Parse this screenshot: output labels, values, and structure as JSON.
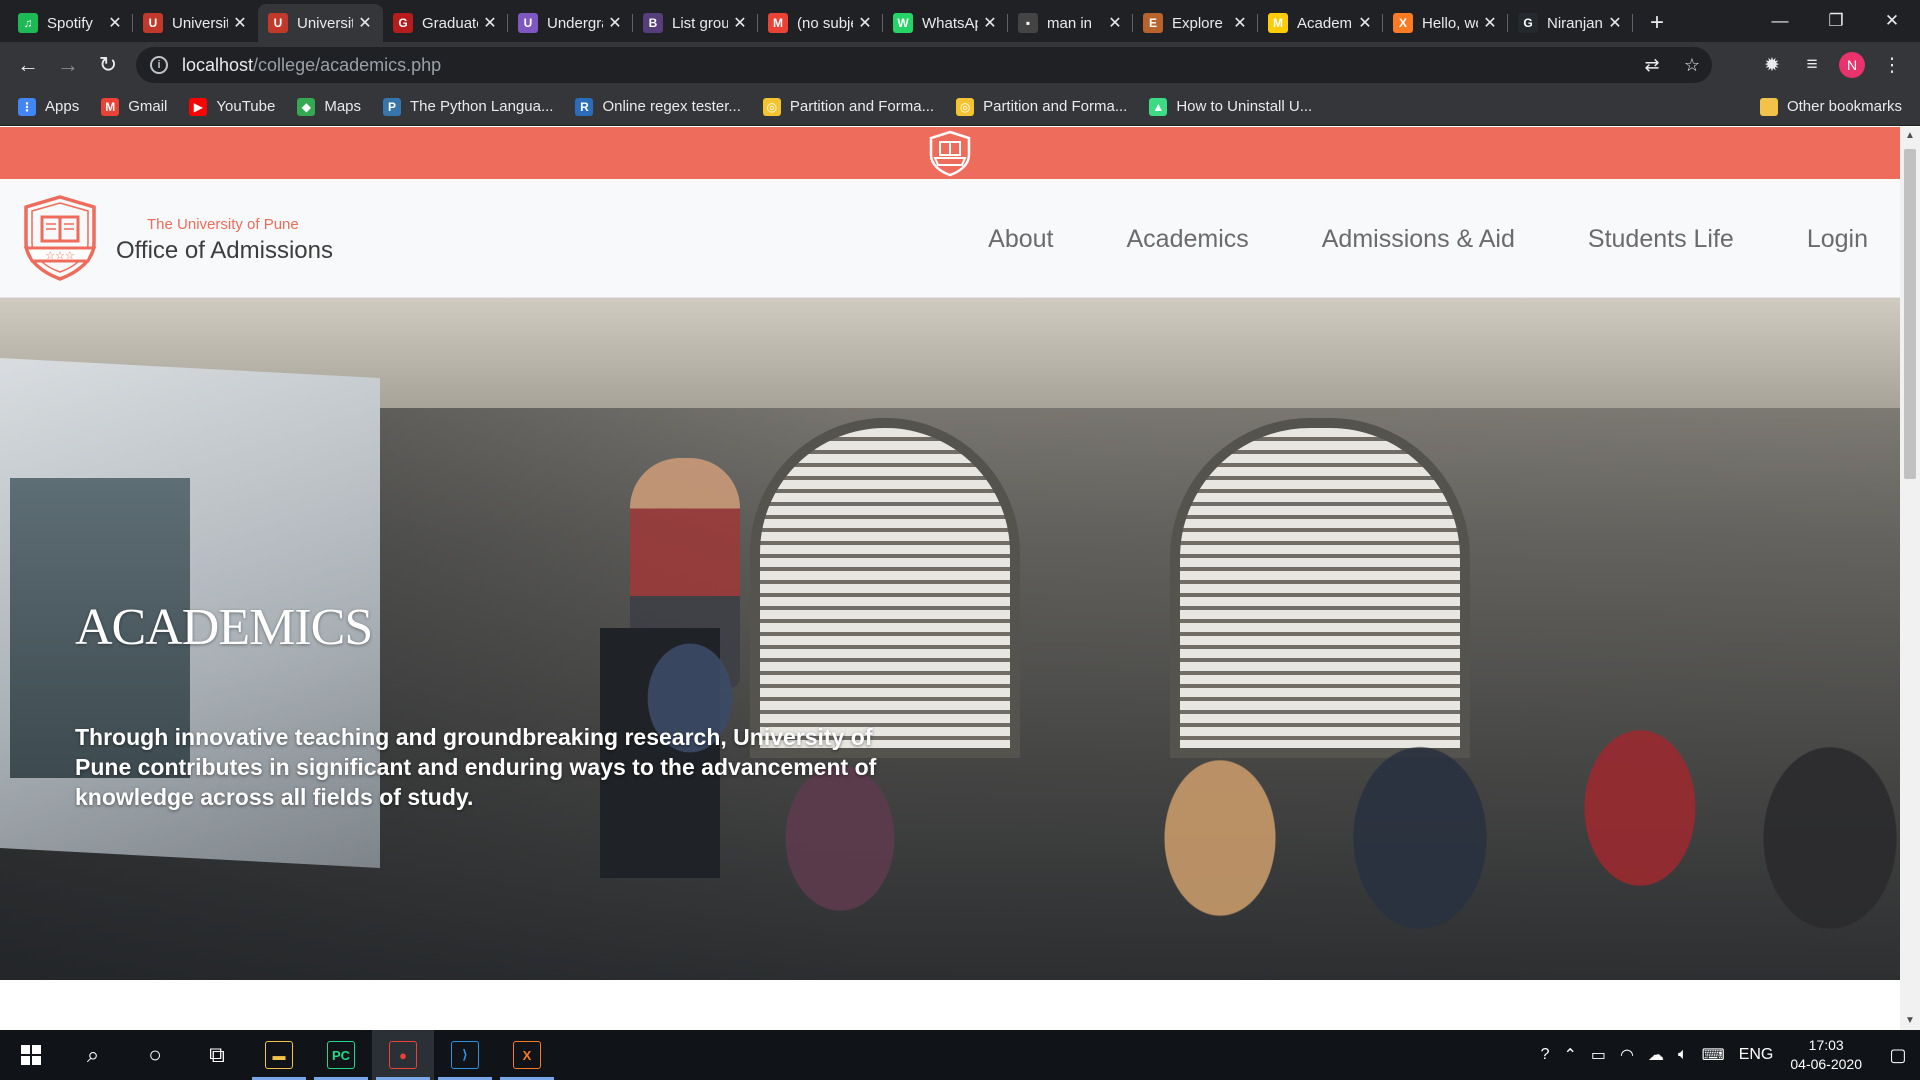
{
  "browser": {
    "tabs": [
      {
        "label": "Spotify",
        "color": "#1db954",
        "glyph": "♫"
      },
      {
        "label": "University",
        "color": "#c0392b",
        "glyph": "U"
      },
      {
        "label": "University",
        "color": "#c0392b",
        "glyph": "U"
      },
      {
        "label": "Graduate",
        "color": "#b71c1c",
        "glyph": "G"
      },
      {
        "label": "Undergraduate",
        "color": "#7e57c2",
        "glyph": "U"
      },
      {
        "label": "List group",
        "color": "#563d7c",
        "glyph": "B"
      },
      {
        "label": "(no subject)",
        "color": "#ea4335",
        "glyph": "M"
      },
      {
        "label": "WhatsApp",
        "color": "#25d366",
        "glyph": "W"
      },
      {
        "label": "man in",
        "color": "#444444",
        "glyph": "▪"
      },
      {
        "label": "Explore",
        "color": "#b8632b",
        "glyph": "E"
      },
      {
        "label": "Academics",
        "color": "#ffcb05",
        "glyph": "M"
      },
      {
        "label": "Hello, world",
        "color": "#fb7a24",
        "glyph": "X"
      },
      {
        "label": "Niranjan",
        "color": "#24292e",
        "glyph": "G"
      }
    ],
    "active_tab_index": 2,
    "new_tab_label": "+",
    "window_controls": {
      "minimize": "—",
      "restore": "❐",
      "close": "✕"
    },
    "url_host": "localhost",
    "url_path": "/college/academics.php",
    "bookmarks": [
      {
        "label": "Apps",
        "color": "#4285f4",
        "glyph": "⋮"
      },
      {
        "label": "Gmail",
        "color": "#ea4335",
        "glyph": "M"
      },
      {
        "label": "YouTube",
        "color": "#ff0000",
        "glyph": "▶"
      },
      {
        "label": "Maps",
        "color": "#34a853",
        "glyph": "◆"
      },
      {
        "label": "The Python Langua...",
        "color": "#3776ab",
        "glyph": "P"
      },
      {
        "label": "Online regex tester...",
        "color": "#2a6ebb",
        "glyph": "R"
      },
      {
        "label": "Partition and Forma...",
        "color": "#f4c430",
        "glyph": "◎"
      },
      {
        "label": "Partition and Forma...",
        "color": "#f4c430",
        "glyph": "◎"
      },
      {
        "label": "How to Uninstall U...",
        "color": "#3ddc84",
        "glyph": "▲"
      }
    ],
    "other_bookmarks": "Other bookmarks",
    "profile_initial": "N"
  },
  "site": {
    "brand_sup": "The University of Pune",
    "brand_title": "Office of Admissions",
    "nav": [
      "About",
      "Academics",
      "Admissions & Aid",
      "Students Life",
      "Login"
    ],
    "accent_color": "#ee6c5b",
    "hero_title": "ACADEMICS",
    "hero_text": "Through innovative teaching and groundbreaking research, University of Pune contributes in significant and enduring ways to the advancement of knowledge across all fields of study."
  },
  "taskbar": {
    "apps": [
      {
        "name": "file-explorer",
        "glyph": "▬",
        "color": "#f3c24a"
      },
      {
        "name": "pycharm",
        "glyph": "PC",
        "color": "#21d789"
      },
      {
        "name": "chrome",
        "glyph": "●",
        "color": "#ea4335"
      },
      {
        "name": "vscode",
        "glyph": "⟩",
        "color": "#2f8fe0"
      },
      {
        "name": "xampp",
        "glyph": "X",
        "color": "#fb7a24"
      }
    ],
    "language": "ENG",
    "time": "17:03",
    "date": "04-06-2020"
  }
}
